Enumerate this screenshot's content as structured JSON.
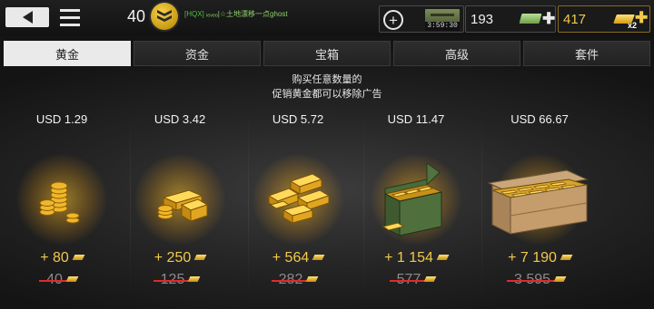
{
  "header": {
    "level": "40",
    "player_name_clan": "[HQX]",
    "player_name_text": "ᵢₑᵥₑₒ|☆土地漂移一点ghost",
    "timer": "3:59:30",
    "credits": "193",
    "gold": "417",
    "gold_multiplier": "x2"
  },
  "tabs": [
    {
      "label": "黄金",
      "active": true
    },
    {
      "label": "资金",
      "active": false
    },
    {
      "label": "宝箱",
      "active": false
    },
    {
      "label": "高级",
      "active": false
    },
    {
      "label": "套件",
      "active": false
    }
  ],
  "promo": {
    "line1": "购买任意数量的",
    "line2": "促销黄金都可以移除广告"
  },
  "offers": [
    {
      "price": "USD 1.29",
      "amount": "+ 80",
      "old_amount": "40",
      "art": "coin-stack"
    },
    {
      "price": "USD 3.42",
      "amount": "+ 250",
      "old_amount": "125",
      "art": "gold-bars-small"
    },
    {
      "price": "USD 5.72",
      "amount": "+ 564",
      "old_amount": "282",
      "art": "gold-bars-pile"
    },
    {
      "price": "USD 11.47",
      "amount": "+ 1 154",
      "old_amount": "577",
      "art": "ammo-box"
    },
    {
      "price": "USD 66.67",
      "amount": "+ 7 190",
      "old_amount": "3 595",
      "art": "wooden-crate"
    }
  ],
  "colors": {
    "gold": "#f2c94c",
    "strike": "#e02a2a",
    "tab_active": "#eaeaea"
  }
}
